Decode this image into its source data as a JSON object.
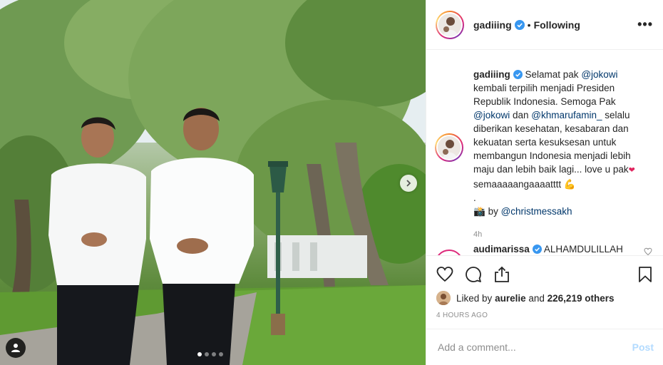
{
  "header": {
    "username": "gadiiing",
    "separator": "•",
    "follow_status": "Following",
    "more_label": "•••"
  },
  "caption": {
    "username": "gadiiing",
    "part1": "Selamat pak ",
    "mention1": "@jokowi",
    "part2": " kembali terpilih menjadi Presiden Republik Indonesia. Semoga Pak ",
    "mention2": "@jokowi",
    "part3": " dan ",
    "mention3": "@khmarufamin_",
    "part4": " selalu diberikan kesehatan, kesabaran dan kekuatan serta kesuksesan untuk membangun Indonesia menjadi lebih maju dan lebih baik lagi... love u pak",
    "emoji_heart": "❤",
    "part5": " semaaaaangaaaatttt ",
    "emoji_muscle": "💪",
    "dot_line": ".",
    "credit_icon": "📸",
    "credit_by": " by ",
    "credit_mention": "@christmessakh",
    "time": "4h"
  },
  "comment2": {
    "username": "audimarissa",
    "text": "ALHAMDULILLAH"
  },
  "actions": {
    "like_icon": "heart-outline-icon",
    "comment_icon": "speech-bubble-icon",
    "share_icon": "share-icon",
    "save_icon": "bookmark-icon"
  },
  "likes": {
    "prefix": "Liked by ",
    "user": "aurelie",
    "middle": " and ",
    "count": "226,219 others"
  },
  "posted": "4 HOURS AGO",
  "comment_box": {
    "placeholder": "Add a comment...",
    "post_label": "Post"
  },
  "carousel": {
    "slides": 4,
    "active_index": 0
  },
  "colors": {
    "verified": "#3897f0",
    "mention": "#00376b",
    "post_disabled": "#b3dbff",
    "muted": "#8e8e8e"
  }
}
